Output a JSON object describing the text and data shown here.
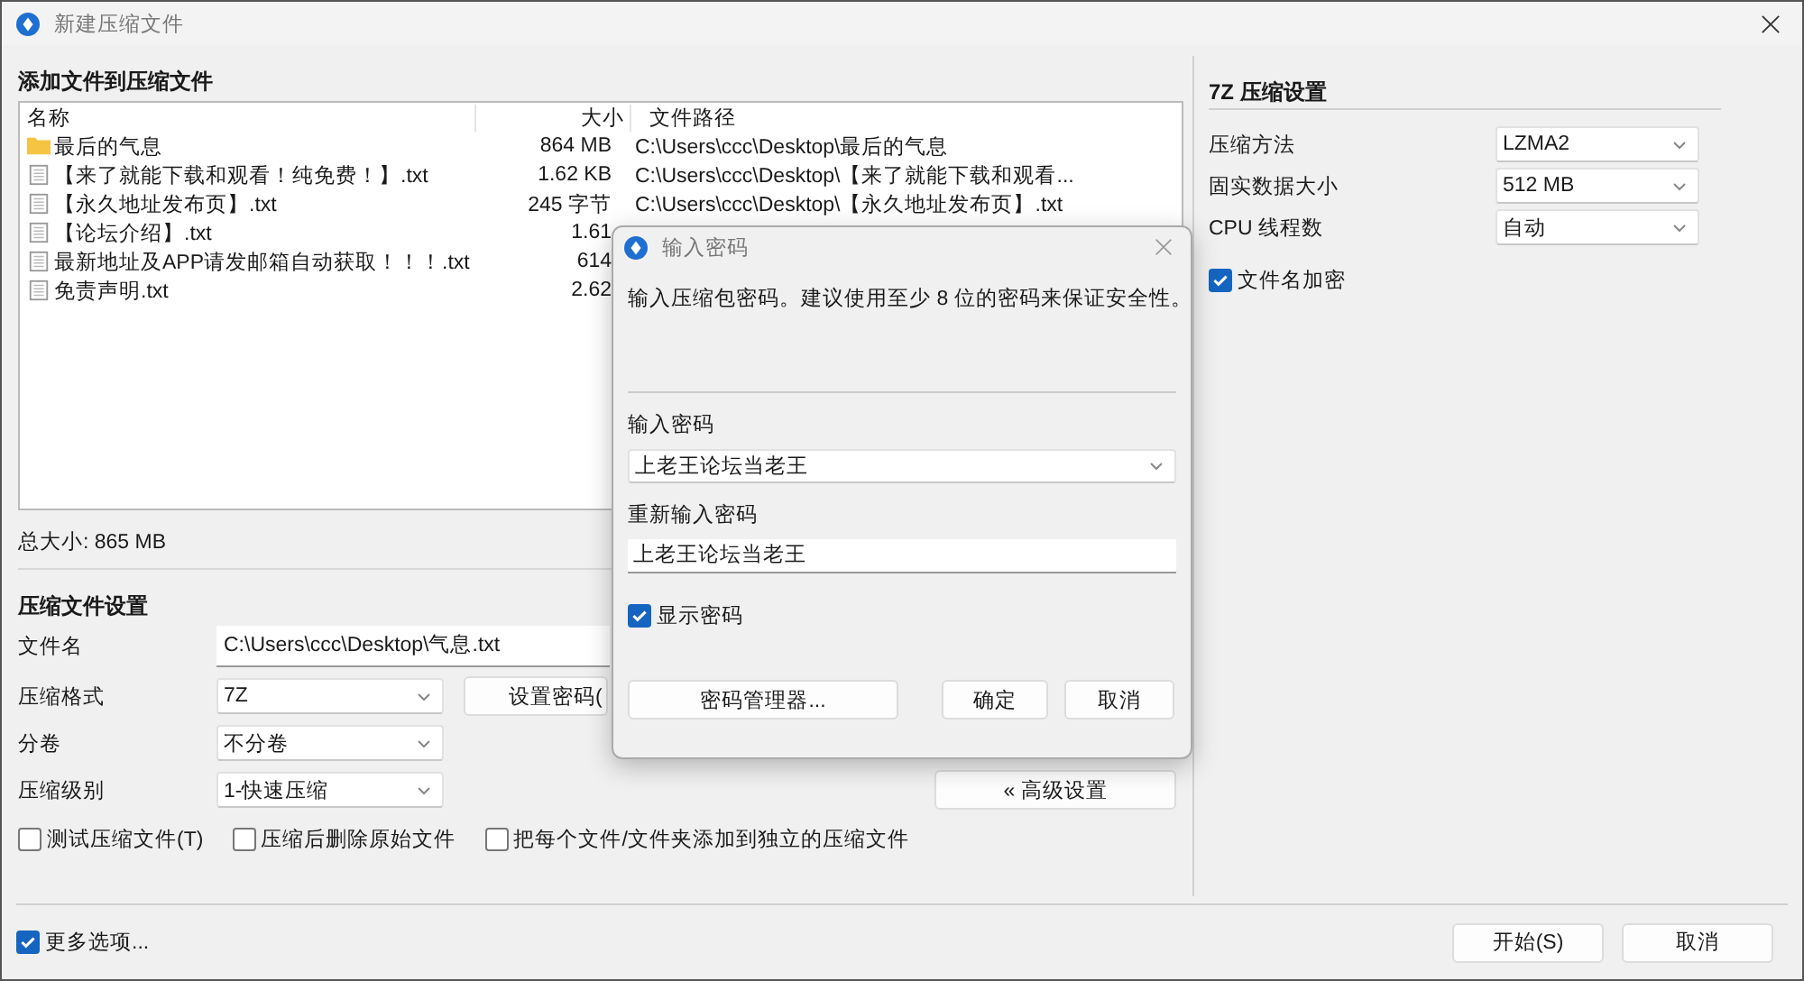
{
  "window": {
    "title": "新建压缩文件"
  },
  "files": {
    "heading": "添加文件到压缩文件",
    "columns": [
      {
        "label": "名称"
      },
      {
        "label": "大小"
      },
      {
        "label": "文件路径"
      }
    ],
    "rows": [
      {
        "kind": "folder",
        "name": "最后的气息",
        "size": "864 MB",
        "path": "C:\\Users\\ccc\\Desktop\\最后的气息"
      },
      {
        "kind": "file",
        "name": "【来了就能下载和观看！纯免费！】.txt",
        "size": "1.62 KB",
        "path": "C:\\Users\\ccc\\Desktop\\【来了就能下载和观看..."
      },
      {
        "kind": "file",
        "name": "【永久地址发布页】.txt",
        "size": "245 字节",
        "path": "C:\\Users\\ccc\\Desktop\\【永久地址发布页】.txt"
      },
      {
        "kind": "file",
        "name": "【论坛介绍】.txt",
        "size": "1.61"
      },
      {
        "kind": "file",
        "name": "最新地址及APP请发邮箱自动获取！！！.txt",
        "size": "614"
      },
      {
        "kind": "file",
        "name": "免责声明.txt",
        "size": "2.62"
      }
    ],
    "total": "总大小: 865 MB"
  },
  "archive_settings": {
    "heading": "压缩文件设置",
    "fields": [
      {
        "kind": "input",
        "label": "文件名",
        "value": "C:\\Users\\ccc\\Desktop\\气息.txt"
      },
      {
        "kind": "select",
        "label": "压缩格式",
        "value": "7Z",
        "button": "设置密码("
      },
      {
        "kind": "select",
        "label": "分卷",
        "value": "不分卷"
      },
      {
        "kind": "select",
        "label": "压缩级别",
        "value": "1-快速压缩",
        "button": "« 高级设置"
      }
    ],
    "options": [
      {
        "label": "测试压缩文件(T)",
        "checked": false
      },
      {
        "label": "压缩后删除原始文件",
        "checked": false
      },
      {
        "label": "把每个文件/文件夹添加到独立的压缩文件",
        "checked": false
      }
    ]
  },
  "format_settings": {
    "heading": "7Z 压缩设置",
    "fields": [
      {
        "label": "压缩方法",
        "value": "LZMA2"
      },
      {
        "label": "固实数据大小",
        "value": "512 MB"
      },
      {
        "label": "CPU 线程数",
        "value": "自动"
      }
    ],
    "options": [
      {
        "label": "文件名加密",
        "checked": true
      }
    ]
  },
  "footer": {
    "more_options": {
      "label": "更多选项...",
      "checked": true
    },
    "buttons": [
      "开始(S)",
      "取消"
    ]
  },
  "password_dialog": {
    "title": "输入密码",
    "message": "输入压缩包密码。建议使用至少 8 位的密码来保证安全性。",
    "password_label": "输入密码",
    "password": "上老王论坛当老王",
    "confirm_label": "重新输入密码",
    "confirm": "上老王论坛当老王",
    "show_password": {
      "label": "显示密码",
      "checked": true
    },
    "buttons": [
      "密码管理器...",
      "确定",
      "取消"
    ]
  }
}
